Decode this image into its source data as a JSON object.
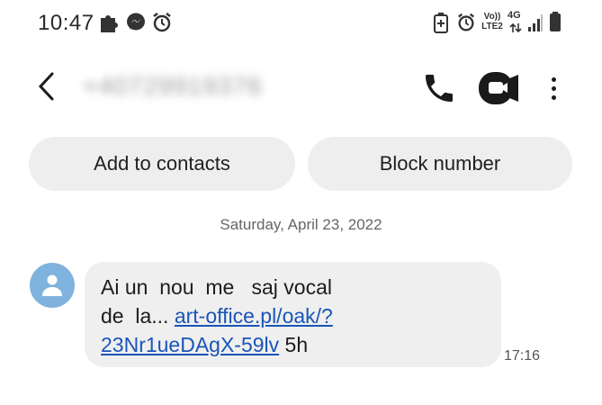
{
  "status_bar": {
    "time": "10:47",
    "left_icons": [
      "puzzle-icon",
      "messenger-icon",
      "alarm-icon"
    ],
    "right_icons": [
      "battery-saver-icon",
      "alarm-icon",
      "volte-icon",
      "4g-icon",
      "signal-icon",
      "battery-icon"
    ],
    "volte_text": "Vo)) LTE2",
    "network_text": "4G"
  },
  "header": {
    "contact_name": "+40729919376",
    "back_icon": "chevron-left-icon",
    "call_icon": "phone-icon",
    "video_icon": "video-call-icon",
    "more_icon": "more-vert-icon"
  },
  "actions": {
    "add_to_contacts": "Add to contacts",
    "block_number": "Block number"
  },
  "conversation": {
    "date": "Saturday, April 23, 2022",
    "message": {
      "line1": "Ai un  nou  me   saj vocal",
      "line2_prefix": "de  la... ",
      "link_part1": "art-office.pl/oak/?",
      "link_part2": "23Nr1ueDAgX-59lv",
      "suffix": " 5h",
      "time": "17:16"
    }
  },
  "colors": {
    "link": "#1a55b8",
    "bubble": "#efefef",
    "pill": "#eeeeee",
    "avatar": "#7fb3dd"
  }
}
